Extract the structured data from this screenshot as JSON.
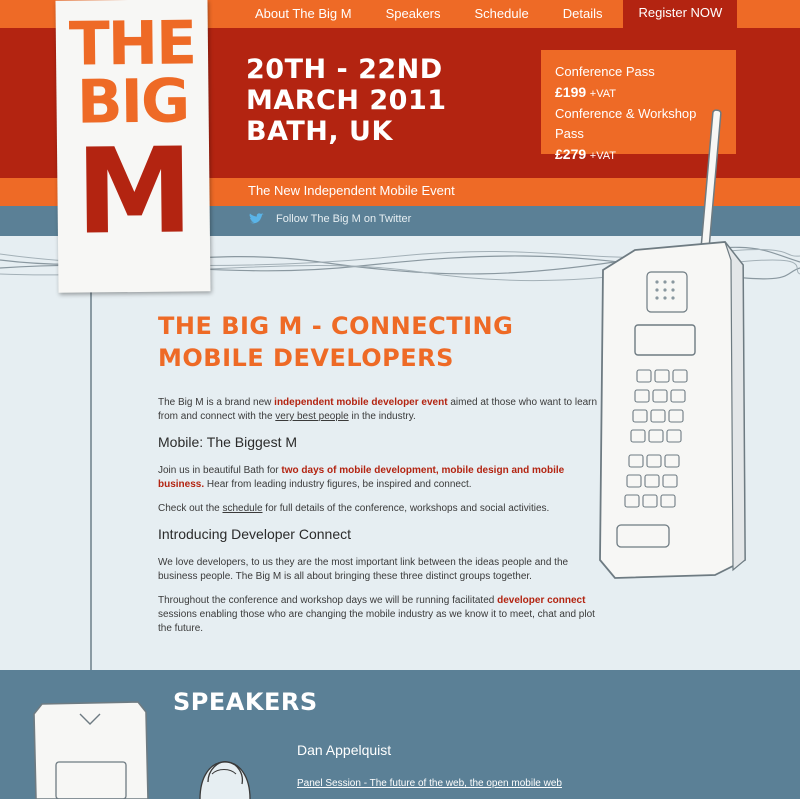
{
  "nav": {
    "items": [
      "About The Big M",
      "Speakers",
      "Schedule",
      "Details"
    ],
    "register": "Register NOW"
  },
  "logo": {
    "line1": "THE",
    "line2": "BIG",
    "line3": "M"
  },
  "event": {
    "date_line1": "20TH - 22ND",
    "date_line2": "MARCH 2011",
    "location": "BATH, UK",
    "tagline": "The New Independent Mobile Event",
    "twitter": "Follow The Big M on Twitter"
  },
  "pricing": {
    "pass1_label": "Conference Pass",
    "pass1_price": "£199",
    "pass2_label": "Conference & Workshop Pass",
    "pass2_price": "£279",
    "vat": "+VAT"
  },
  "main": {
    "heading_line1": "THE BIG M - CONNECTING",
    "heading_line2": "MOBILE DEVELOPERS",
    "intro_a": "The Big M is a brand new ",
    "intro_link": "independent mobile developer event",
    "intro_b": " aimed at those who want to learn from and connect with the ",
    "intro_link2": "very best people",
    "intro_c": " in the industry.",
    "sub1": "Mobile: The Biggest M",
    "p2_a": "Join us in beautiful Bath for ",
    "p2_link": "two days of mobile development, mobile design and mobile business.",
    "p2_b": " Hear from leading industry figures, be inspired and connect.",
    "p3_a": "Check out the ",
    "p3_link": "schedule",
    "p3_b": " for full details of the conference, workshops and social activities.",
    "sub2": "Introducing Developer Connect",
    "p4": "We love developers, to us they are the most important link between the ideas people and the business people. The Big M is all about bringing these three distinct groups together.",
    "p5_a": "Throughout the conference and workshop days we will be running facilitated ",
    "p5_link": "developer connect",
    "p5_b": " sessions enabling those who are changing the mobile industry as we know it to meet, chat and plot the future."
  },
  "speakers": {
    "heading": "SPEAKERS",
    "name": "Dan Appelquist",
    "session": "Panel Session - The future of the web, the open mobile web"
  },
  "colors": {
    "orange": "#ee6a26",
    "red": "#b32411",
    "blue": "#5b8096",
    "background": "#e6eef2"
  }
}
